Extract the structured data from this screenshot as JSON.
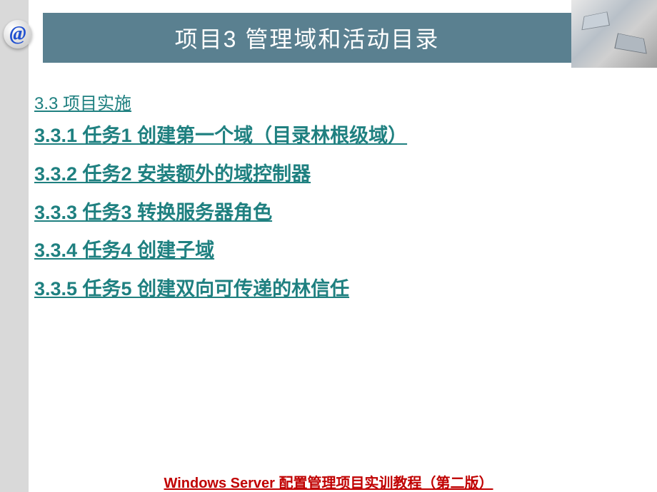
{
  "icon": {
    "at_symbol": "@"
  },
  "title": "项目3  管理域和活动目录",
  "subsection": "3.3  项目实施",
  "tasks": [
    "3.3.1 任务1 创建第一个域（目录林根级域）",
    "3.3.2 任务2 安装额外的域控制器",
    "3.3.3 任务3 转换服务器角色",
    "3.3.4 任务4 创建子域",
    "3.3.5 任务5 创建双向可传递的林信任"
  ],
  "footer": "Windows Server 配置管理项目实训教程（第二版）"
}
